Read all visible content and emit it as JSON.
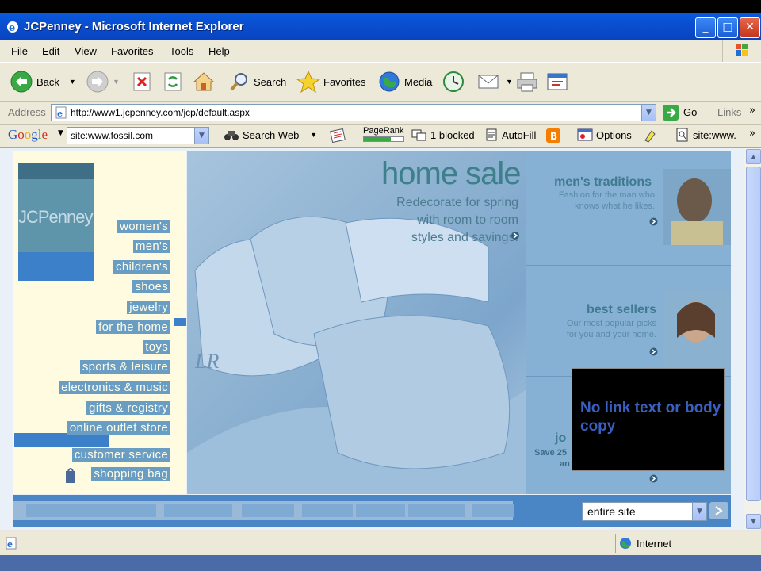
{
  "window": {
    "title": "JCPenney - Microsoft Internet Explorer"
  },
  "menu": [
    "File",
    "Edit",
    "View",
    "Favorites",
    "Tools",
    "Help"
  ],
  "toolbar": {
    "back": "Back",
    "search": "Search",
    "favorites": "Favorites",
    "media": "Media"
  },
  "address": {
    "label": "Address",
    "url": "http://www1.jcpenney.com/jcp/default.aspx",
    "go": "Go",
    "links": "Links"
  },
  "googlebar": {
    "logo": "Google",
    "query": "site:www.fossil.com",
    "search_web": "Search Web",
    "pagerank": "PageRank",
    "blocked": "1 blocked",
    "autofill": "AutoFill",
    "options": "Options",
    "site_field": "site:www."
  },
  "page": {
    "logo_text": "JCPenney",
    "nav_links": [
      "women's",
      "men's",
      "children's",
      "shoes",
      "jewelry",
      "for the home",
      "toys",
      "sports & leisure",
      "electronics & music",
      "gifts & registry",
      "online outlet store",
      "customer service",
      "shopping bag"
    ],
    "hero": {
      "headline": "home sale",
      "lines": [
        "Redecorate for spring",
        "with room to room",
        "styles and savings."
      ],
      "monogram": "LR"
    },
    "promos": [
      {
        "title": "men's traditions",
        "lines": [
          "Fashion for the man who",
          "knows what he likes."
        ]
      },
      {
        "title": "best sellers",
        "lines": [
          "Our most popular picks",
          "for you and your home."
        ]
      },
      {
        "title": "jo",
        "lines": [
          "Save 25",
          "an"
        ]
      }
    ],
    "overlay_note": "No link text or body copy",
    "search_select": "entire site"
  },
  "status": {
    "zone": "Internet"
  }
}
